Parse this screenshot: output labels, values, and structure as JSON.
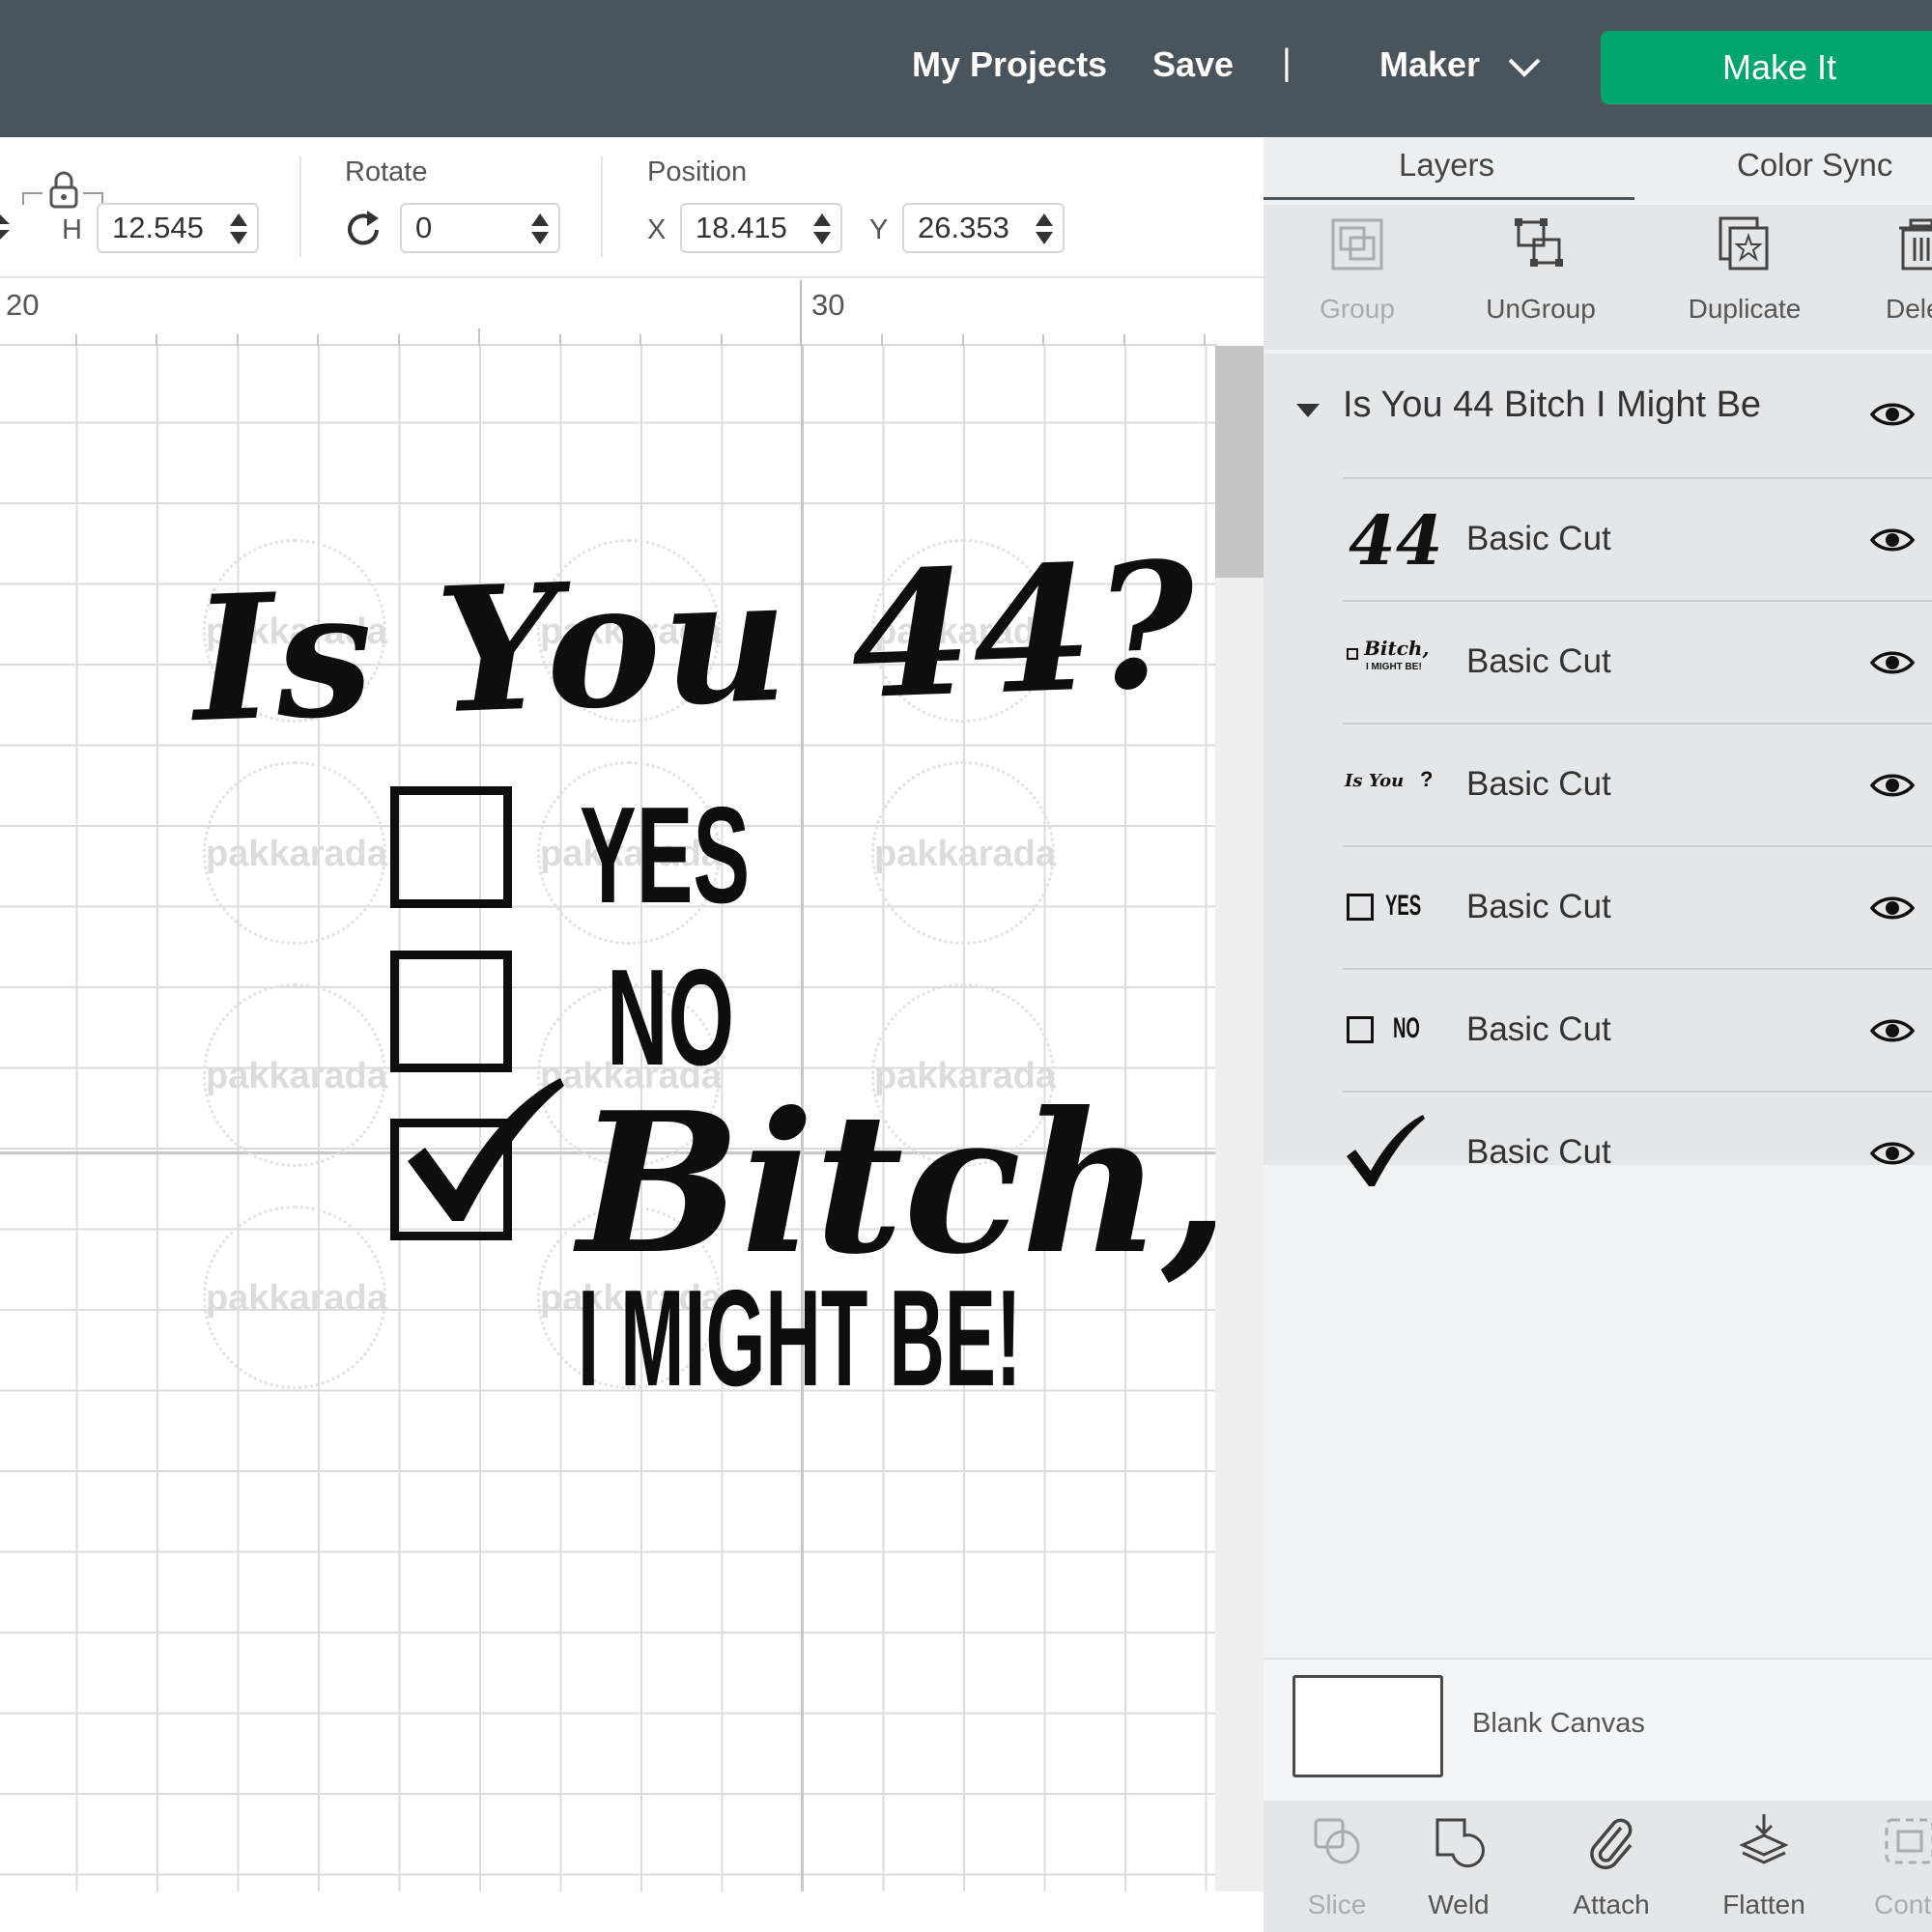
{
  "topbar": {
    "my_projects": "My Projects",
    "save": "Save",
    "separator": "|",
    "machine": "Maker",
    "make_it": "Make It",
    "accent_color": "#00a66e",
    "bg_color": "#4a545c"
  },
  "toolbar": {
    "size_h_label": "H",
    "size_h_value": "12.545",
    "rotate_label": "Rotate",
    "rotate_value": "0",
    "position_label": "Position",
    "x_label": "X",
    "x_value": "18.415",
    "y_label": "Y",
    "y_value": "26.353"
  },
  "ruler": {
    "marks": [
      "20",
      "30"
    ]
  },
  "canvas": {
    "watermark": "pakkarada",
    "design": {
      "title": "Is You 44?",
      "option_yes": "YES",
      "option_no": "NO",
      "script_word": "Bitch,",
      "tagline": "I MIGHT BE!"
    }
  },
  "panel": {
    "tabs": [
      "Layers",
      "Color Sync"
    ],
    "actions": [
      {
        "label": "Group",
        "icon": "group-icon",
        "enabled": false
      },
      {
        "label": "UnGroup",
        "icon": "ungroup-icon",
        "enabled": true
      },
      {
        "label": "Duplicate",
        "icon": "duplicate-icon",
        "enabled": true
      },
      {
        "label": "Dele",
        "icon": "trash-icon",
        "enabled": true
      }
    ],
    "group_name": "Is You 44 Bitch I Might Be",
    "layers": [
      {
        "name": "Basic Cut",
        "thumb": "44"
      },
      {
        "name": "Basic Cut",
        "thumb_top": "Bitch,",
        "thumb_bottom": "I MIGHT BE!"
      },
      {
        "name": "Basic Cut",
        "thumb": "Is You",
        "thumb_mark": "?"
      },
      {
        "name": "Basic Cut",
        "thumb": "YES"
      },
      {
        "name": "Basic Cut",
        "thumb": "NO"
      },
      {
        "name": "Basic Cut",
        "thumb": "checkmark"
      }
    ],
    "blank_canvas": "Blank Canvas",
    "bottom_actions": [
      {
        "label": "Slice",
        "icon": "slice-icon",
        "enabled": false
      },
      {
        "label": "Weld",
        "icon": "weld-icon",
        "enabled": true
      },
      {
        "label": "Attach",
        "icon": "paperclip-icon",
        "enabled": true
      },
      {
        "label": "Flatten",
        "icon": "flatten-icon",
        "enabled": true
      },
      {
        "label": "Cont",
        "icon": "contour-icon",
        "enabled": false
      }
    ]
  }
}
